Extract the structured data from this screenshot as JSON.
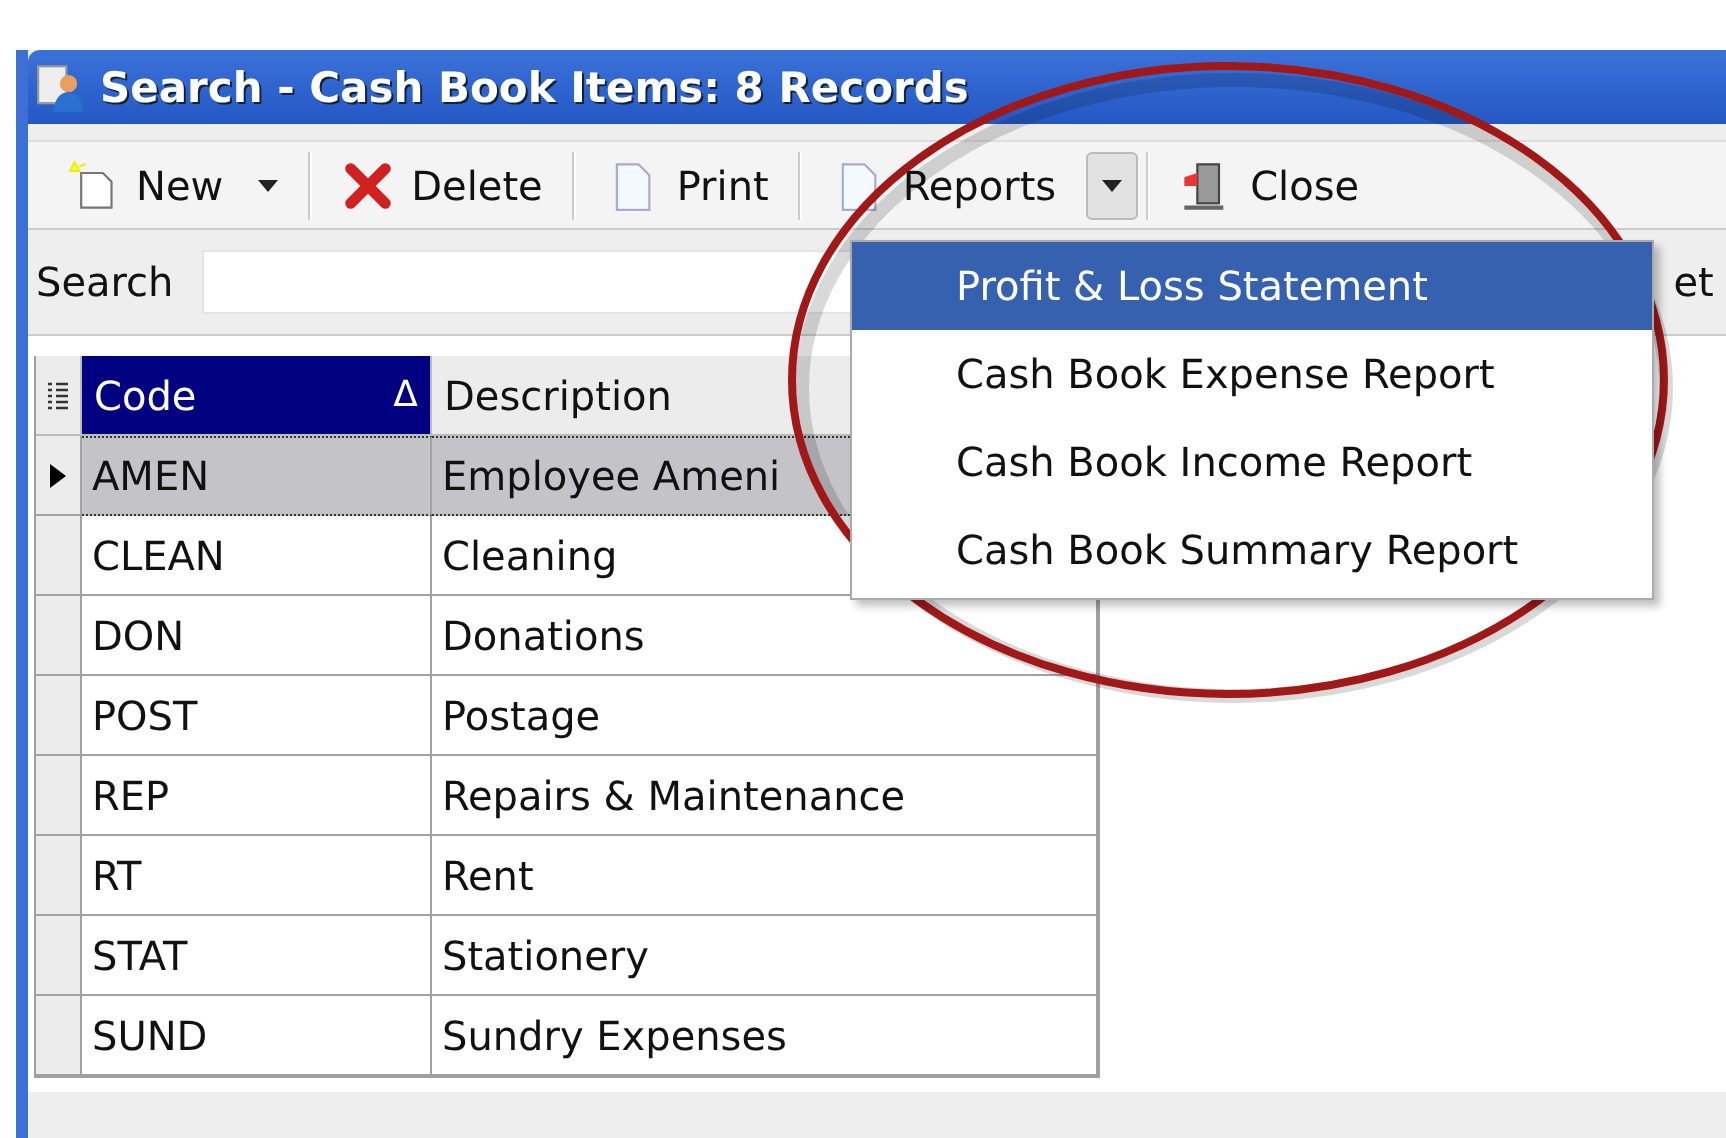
{
  "window": {
    "title": "Search - Cash Book Items: 8 Records"
  },
  "toolbar": [
    {
      "label": "New",
      "kind": "dropdown"
    },
    {
      "label": "Delete",
      "kind": "button"
    },
    {
      "label": "Print",
      "kind": "button"
    },
    {
      "label": "Reports",
      "kind": "split"
    },
    {
      "label": "Close",
      "kind": "button"
    }
  ],
  "search": {
    "label": "Search",
    "cut_label": "et"
  },
  "table": {
    "columns": [
      {
        "label": "Code",
        "sort": "Δ",
        "selected": true
      },
      {
        "label": "Description",
        "selected": false
      }
    ],
    "rows": [
      {
        "code": "AMEN",
        "description": "Employee Ameni",
        "selected": true
      },
      {
        "code": "CLEAN",
        "description": "Cleaning",
        "selected": false
      },
      {
        "code": "DON",
        "description": "Donations",
        "selected": false
      },
      {
        "code": "POST",
        "description": "Postage",
        "selected": false
      },
      {
        "code": "REP",
        "description": "Repairs & Maintenance",
        "selected": false
      },
      {
        "code": "RT",
        "description": "Rent",
        "selected": false
      },
      {
        "code": "STAT",
        "description": "Stationery",
        "selected": false
      },
      {
        "code": "SUND",
        "description": "Sundry Expenses",
        "selected": false
      }
    ]
  },
  "reports_menu": {
    "items": [
      {
        "label": "Profit & Loss Statement",
        "selected": true
      },
      {
        "label": "Cash Book Expense Report",
        "selected": false
      },
      {
        "label": "Cash Book Income Report",
        "selected": false
      },
      {
        "label": "Cash Book Summary Report",
        "selected": false
      }
    ]
  }
}
